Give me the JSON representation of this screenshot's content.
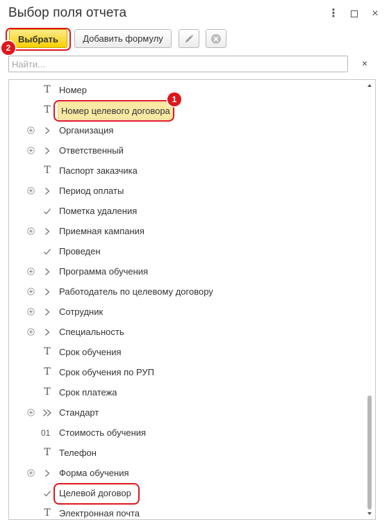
{
  "window": {
    "title": "Выбор поля отчета",
    "more_icon": "⋮",
    "maximize_icon": "maximize-icon",
    "close_icon": "×"
  },
  "toolbar": {
    "select_label": "Выбрать",
    "formula_label": "Добавить формулу",
    "edit_icon": "pencil-icon",
    "delete_icon": "delete-circle-icon"
  },
  "search": {
    "placeholder": "Найти...",
    "value": "",
    "clear_icon": "×"
  },
  "annotations": {
    "badge_1": "1",
    "badge_2": "2"
  },
  "colors": {
    "accent_yellow": "#f6d100",
    "highlight_red": "#e0161b",
    "selected_bg": "#f9e9a5"
  },
  "fields": [
    {
      "label": "Номер",
      "icon": "T",
      "expandable": false
    },
    {
      "label": "Номер целевого договора",
      "icon": "T",
      "expandable": false,
      "selected": true
    },
    {
      "label": "Организация",
      "icon": ">",
      "expandable": true
    },
    {
      "label": "Ответственный",
      "icon": ">",
      "expandable": true
    },
    {
      "label": "Паспорт заказчика",
      "icon": "T",
      "expandable": false
    },
    {
      "label": "Период оплаты",
      "icon": ">",
      "expandable": true
    },
    {
      "label": "Пометка удаления",
      "icon": "✓",
      "expandable": false
    },
    {
      "label": "Приемная кампания",
      "icon": ">",
      "expandable": true
    },
    {
      "label": "Проведен",
      "icon": "✓",
      "expandable": false
    },
    {
      "label": "Программа обучения",
      "icon": ">",
      "expandable": true
    },
    {
      "label": "Работодатель по целевому договору",
      "icon": ">",
      "expandable": true
    },
    {
      "label": "Сотрудник",
      "icon": ">",
      "expandable": true
    },
    {
      "label": "Специальность",
      "icon": ">",
      "expandable": true
    },
    {
      "label": "Срок обучения",
      "icon": "T",
      "expandable": false
    },
    {
      "label": "Срок обучения по РУП",
      "icon": "T",
      "expandable": false
    },
    {
      "label": "Срок платежа",
      "icon": "T",
      "expandable": false
    },
    {
      "label": "Стандарт",
      "icon": ">>",
      "expandable": true
    },
    {
      "label": "Стоимость обучения",
      "icon": "01",
      "expandable": false
    },
    {
      "label": "Телефон",
      "icon": "T",
      "expandable": false
    },
    {
      "label": "Форма обучения",
      "icon": ">",
      "expandable": true
    },
    {
      "label": "Целевой договор",
      "icon": "✓",
      "expandable": false
    },
    {
      "label": "Электронная почта",
      "icon": "T",
      "expandable": false
    }
  ]
}
